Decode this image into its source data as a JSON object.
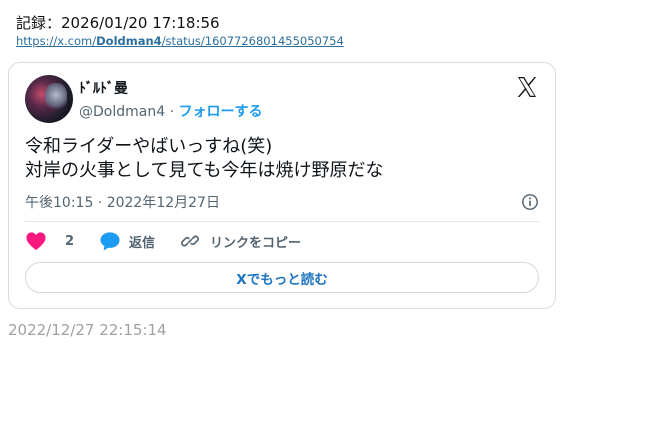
{
  "record": {
    "text": "記録：2026/01/20 17:18:56"
  },
  "link": {
    "prefix": "https://x.com/",
    "user": "Doldman4",
    "suffix": "/status/1607726801455050754"
  },
  "tweet": {
    "display_name": "ﾄﾞﾙﾄﾞ曼",
    "handle": "@Doldman4",
    "separator": " · ",
    "follow_label": "フォローする",
    "lines": [
      "令和ライダーやばいっすね(笑)",
      "対岸の火事として見ても今年は焼け野原だな"
    ],
    "timestamp": "午後10:15 · 2022年12月27日",
    "like_count": "2",
    "reply_label": "返信",
    "copy_link_label": "リンクをコピー",
    "read_more_label": "Xでもっと読む"
  },
  "footer": {
    "date": "2022/12/27 22:15:14"
  },
  "colors": {
    "accent_blue": "#1d9bf0",
    "like_pink": "#f91880",
    "muted": "#536471",
    "link": "#2d6f9e"
  }
}
